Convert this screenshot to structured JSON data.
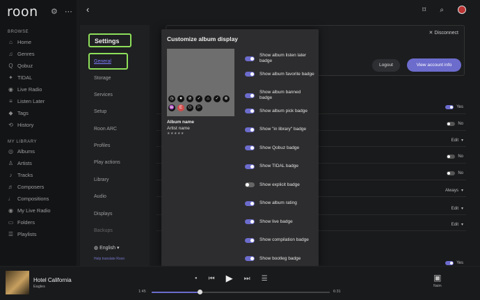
{
  "app": {
    "logo": "roon"
  },
  "sidebar": {
    "browse_heading": "BROWSE",
    "browse_items": [
      {
        "label": "Home",
        "icon": "home-icon",
        "glyph": "⌂"
      },
      {
        "label": "Genres",
        "icon": "genres-icon",
        "glyph": "♫"
      },
      {
        "label": "Qobuz",
        "icon": "qobuz-icon",
        "glyph": "Q"
      },
      {
        "label": "TIDAL",
        "icon": "tidal-icon",
        "glyph": "✦"
      },
      {
        "label": "Live Radio",
        "icon": "radio-icon",
        "glyph": "◉"
      },
      {
        "label": "Listen Later",
        "icon": "listen-later-icon",
        "glyph": "≡"
      },
      {
        "label": "Tags",
        "icon": "tag-icon",
        "glyph": "◆"
      },
      {
        "label": "History",
        "icon": "history-icon",
        "glyph": "⟲"
      }
    ],
    "library_heading": "MY LIBRARY",
    "library_items": [
      {
        "label": "Albums",
        "icon": "albums-icon",
        "glyph": "◎"
      },
      {
        "label": "Artists",
        "icon": "artists-icon",
        "glyph": "♙"
      },
      {
        "label": "Tracks",
        "icon": "tracks-icon",
        "glyph": "♪"
      },
      {
        "label": "Composers",
        "icon": "composers-icon",
        "glyph": "♬"
      },
      {
        "label": "Compositions",
        "icon": "compositions-icon",
        "glyph": "♩"
      },
      {
        "label": "My Live Radio",
        "icon": "my-radio-icon",
        "glyph": "◉"
      },
      {
        "label": "Folders",
        "icon": "folder-icon",
        "glyph": "▭"
      },
      {
        "label": "Playlists",
        "icon": "playlist-icon",
        "glyph": "☰"
      }
    ]
  },
  "settings": {
    "title": "Settings",
    "general": "General",
    "items": [
      "Storage",
      "Services",
      "Setup",
      "Roon ARC",
      "Profiles",
      "Play actions",
      "Library",
      "Audio",
      "Displays",
      "Backups"
    ],
    "language": "English",
    "help_translate": "Help translate Roon"
  },
  "account": {
    "disconnect": "Disconnect",
    "logout": "Logout",
    "view_account": "View account info"
  },
  "right_rows": [
    {
      "value": "Yes",
      "toggle": "on"
    },
    {
      "value": "No",
      "toggle": "off"
    },
    {
      "value": "Edit",
      "toggle": "dropdown"
    },
    {
      "value": "No",
      "toggle": "off"
    },
    {
      "value": "No",
      "toggle": "off"
    },
    {
      "value": "Always",
      "toggle": "dropdown"
    },
    {
      "value": "Edit",
      "toggle": "dropdown"
    },
    {
      "value": "Edit",
      "toggle": "dropdown"
    },
    {
      "value": "Yes",
      "toggle": "on"
    }
  ],
  "modal": {
    "title": "Customize album display",
    "album_name": "Album name",
    "artist_name": "Artist name",
    "rating_stars": "★★★★★",
    "options": [
      {
        "label": "Show album listen later badge",
        "on": true
      },
      {
        "label": "Show album favorite badge",
        "on": true
      },
      {
        "label": "Show album banned badge",
        "on": true
      },
      {
        "label": "Show album pick badge",
        "on": true
      },
      {
        "label": "Show \"in library\" badge",
        "on": true
      },
      {
        "label": "Show Qobuz badge",
        "on": true
      },
      {
        "label": "Show TIDAL badge",
        "on": true
      },
      {
        "label": "Show explicit badge",
        "on": false
      },
      {
        "label": "Show album rating",
        "on": true
      },
      {
        "label": "Show live badge",
        "on": true
      },
      {
        "label": "Show compilation badge",
        "on": true
      },
      {
        "label": "Show bootleg badge",
        "on": true
      }
    ],
    "badge_icons": [
      "listen-later-badge-icon",
      "favorite-badge-icon",
      "banned-badge-icon",
      "pick-badge-icon",
      "library-badge-icon",
      "qobuz-badge-icon",
      "tidal-badge-icon",
      "live-badge-icon",
      "explicit-badge-icon",
      "compilation-badge-icon",
      "bootleg-badge-icon"
    ]
  },
  "player": {
    "track_title": "Hotel California",
    "artist": "Eagles",
    "elapsed": "1:45",
    "duration": "6:31",
    "progress": 0.27,
    "zone_name": "Naim"
  },
  "colors": {
    "accent": "#6c6ccd",
    "highlight": "#8ee05a",
    "background": "#191a1c"
  }
}
